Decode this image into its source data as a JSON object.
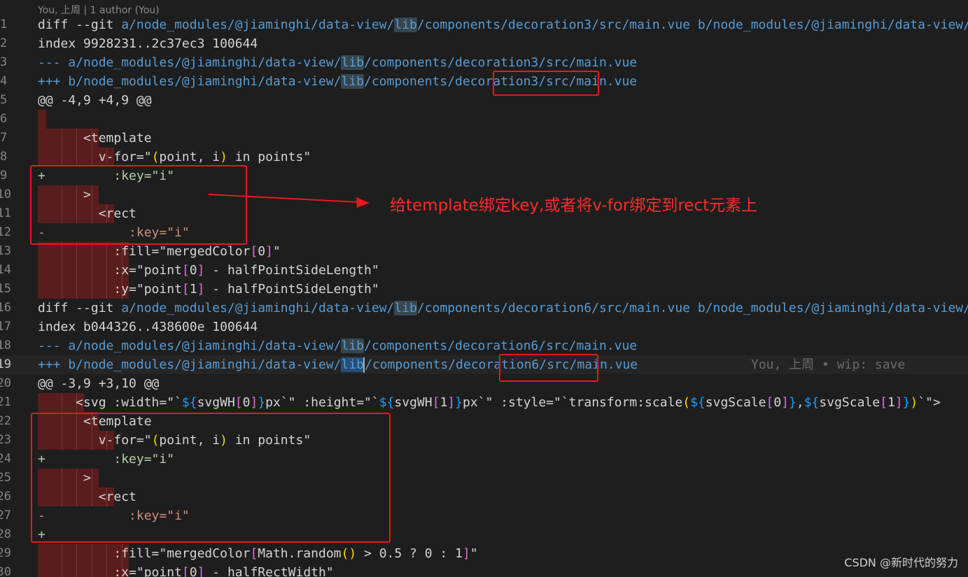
{
  "codelens": "You, 上周 | 1 author (You)",
  "blame": "You, 上周 • wip: save",
  "annotation": "给template绑定key,或者将v-for绑定到rect元素上",
  "watermark": "CSDN @新时代的努力",
  "lines": [
    {
      "n": "1",
      "segs": [
        {
          "c": "meta",
          "t": "diff --git "
        },
        {
          "c": "path",
          "t": "a/node_modules/@jiaminghi/data-view/"
        },
        {
          "c": "path hlword",
          "t": "lib"
        },
        {
          "c": "path",
          "t": "/components/decoration3/src/main.vue b/node_modules/@jiaminghi/data-view/lib/components/decoration3/src/main.vue"
        }
      ]
    },
    {
      "n": "2",
      "segs": [
        {
          "c": "meta",
          "t": "index 9928231..2c37ec3 100644"
        }
      ]
    },
    {
      "n": "3",
      "segs": [
        {
          "c": "path",
          "t": "--- a/node_modules/@jiaminghi/data-view/"
        },
        {
          "c": "path hlword",
          "t": "lib"
        },
        {
          "c": "path",
          "t": "/components/decoration3/src/main.vue"
        }
      ]
    },
    {
      "n": "4",
      "segs": [
        {
          "c": "path",
          "t": "+++ b/node_modules/@jiaminghi/data-view/"
        },
        {
          "c": "path hlword",
          "t": "lib"
        },
        {
          "c": "path",
          "t": "/components/decoration3/src/main.vue"
        }
      ]
    },
    {
      "n": "5",
      "segs": [
        {
          "c": "meta",
          "t": "@@ -4,9 +4,9 @@"
        }
      ]
    },
    {
      "n": "6",
      "indent": 1,
      "segs": []
    },
    {
      "n": "7",
      "indent": 4,
      "segs": [
        {
          "c": "tag",
          "t": "      <template"
        }
      ]
    },
    {
      "n": "8",
      "indent": 5,
      "segs": [
        {
          "c": "attr",
          "t": "        v-for=\""
        },
        {
          "c": "paren",
          "t": "("
        },
        {
          "c": "attr",
          "t": "point, i"
        },
        {
          "c": "paren",
          "t": ")"
        },
        {
          "c": "attr",
          "t": " in points\""
        }
      ]
    },
    {
      "n": "9",
      "segs": [
        {
          "c": "add",
          "t": "+         :key=\"i\""
        }
      ]
    },
    {
      "n": "10",
      "indent": 4,
      "segs": [
        {
          "c": "tag",
          "t": "      >"
        }
      ]
    },
    {
      "n": "11",
      "indent": 5,
      "segs": [
        {
          "c": "tag",
          "t": "        <rect"
        }
      ]
    },
    {
      "n": "12",
      "segs": [
        {
          "c": "del",
          "t": "-           :key=\"i\""
        }
      ]
    },
    {
      "n": "13",
      "indent": 6,
      "segs": [
        {
          "c": "attr",
          "t": "          :fill=\"mergedColor"
        },
        {
          "c": "idx",
          "t": "["
        },
        {
          "c": "attr",
          "t": "0"
        },
        {
          "c": "idx",
          "t": "]"
        },
        {
          "c": "attr",
          "t": "\""
        }
      ]
    },
    {
      "n": "14",
      "indent": 6,
      "segs": [
        {
          "c": "attr",
          "t": "          :x=\"point"
        },
        {
          "c": "idx",
          "t": "["
        },
        {
          "c": "attr",
          "t": "0"
        },
        {
          "c": "idx",
          "t": "]"
        },
        {
          "c": "attr",
          "t": " - halfPointSideLength\""
        }
      ]
    },
    {
      "n": "15",
      "indent": 6,
      "segs": [
        {
          "c": "attr",
          "t": "          :y=\"point"
        },
        {
          "c": "idx",
          "t": "["
        },
        {
          "c": "attr",
          "t": "1"
        },
        {
          "c": "idx",
          "t": "]"
        },
        {
          "c": "attr",
          "t": " - halfPointSideLength\""
        }
      ]
    },
    {
      "n": "16",
      "segs": [
        {
          "c": "meta",
          "t": "diff --git "
        },
        {
          "c": "path",
          "t": "a/node_modules/@jiaminghi/data-view/"
        },
        {
          "c": "path hlword",
          "t": "lib"
        },
        {
          "c": "path",
          "t": "/components/decoration6/src/main.vue b/node_modules/@jiaminghi/data-view/lib/components/decoration6/src/main.vue"
        }
      ]
    },
    {
      "n": "17",
      "segs": [
        {
          "c": "meta",
          "t": "index b044326..438600e 100644"
        }
      ]
    },
    {
      "n": "18",
      "segs": [
        {
          "c": "path",
          "t": "--- a/node_modules/@jiaminghi/data-view/"
        },
        {
          "c": "path hlword",
          "t": "lib"
        },
        {
          "c": "path",
          "t": "/components/decoration6/src/main.vue"
        }
      ]
    },
    {
      "n": "19",
      "cursor": true,
      "segs": [
        {
          "c": "path",
          "t": "+++ b/node_modules/@jiaminghi/data-view/"
        },
        {
          "c": "path hlword strong",
          "t": "lib"
        },
        {
          "c": "caret",
          "t": ""
        },
        {
          "c": "path",
          "t": "/components/decoration6/src/main.vue"
        }
      ]
    },
    {
      "n": "20",
      "segs": [
        {
          "c": "meta",
          "t": "@@ -3,9 +3,10 @@"
        }
      ]
    },
    {
      "n": "21",
      "indent": 3,
      "segs": [
        {
          "c": "tag",
          "t": "     <svg :width=\"`"
        },
        {
          "c": "brace",
          "t": "${"
        },
        {
          "c": "attr",
          "t": "svgWH"
        },
        {
          "c": "idx",
          "t": "["
        },
        {
          "c": "attr",
          "t": "0"
        },
        {
          "c": "idx",
          "t": "]"
        },
        {
          "c": "brace",
          "t": "}"
        },
        {
          "c": "attr",
          "t": "px`\" :height=\"`"
        },
        {
          "c": "brace",
          "t": "${"
        },
        {
          "c": "attr",
          "t": "svgWH"
        },
        {
          "c": "idx",
          "t": "["
        },
        {
          "c": "attr",
          "t": "1"
        },
        {
          "c": "idx",
          "t": "]"
        },
        {
          "c": "brace",
          "t": "}"
        },
        {
          "c": "attr",
          "t": "px`\" :style=\"`transform:scale"
        },
        {
          "c": "paren",
          "t": "("
        },
        {
          "c": "brace",
          "t": "${"
        },
        {
          "c": "attr",
          "t": "svgScale"
        },
        {
          "c": "idx",
          "t": "["
        },
        {
          "c": "attr",
          "t": "0"
        },
        {
          "c": "idx",
          "t": "]"
        },
        {
          "c": "brace",
          "t": "}"
        },
        {
          "c": "attr",
          "t": ","
        },
        {
          "c": "brace",
          "t": "${"
        },
        {
          "c": "attr",
          "t": "svgScale"
        },
        {
          "c": "idx",
          "t": "["
        },
        {
          "c": "attr",
          "t": "1"
        },
        {
          "c": "idx",
          "t": "]"
        },
        {
          "c": "brace",
          "t": "}"
        },
        {
          "c": "paren",
          "t": ")"
        },
        {
          "c": "attr",
          "t": "`\">"
        }
      ]
    },
    {
      "n": "22",
      "indent": 4,
      "segs": [
        {
          "c": "tag",
          "t": "      <template"
        }
      ]
    },
    {
      "n": "23",
      "indent": 5,
      "segs": [
        {
          "c": "attr",
          "t": "        v-for=\""
        },
        {
          "c": "paren",
          "t": "("
        },
        {
          "c": "attr",
          "t": "point, i"
        },
        {
          "c": "paren",
          "t": ")"
        },
        {
          "c": "attr",
          "t": " in points\""
        }
      ]
    },
    {
      "n": "24",
      "segs": [
        {
          "c": "add",
          "t": "+         :key=\"i\""
        }
      ]
    },
    {
      "n": "25",
      "indent": 4,
      "segs": [
        {
          "c": "tag",
          "t": "      >"
        }
      ]
    },
    {
      "n": "26",
      "indent": 5,
      "segs": [
        {
          "c": "tag",
          "t": "        <rect"
        }
      ]
    },
    {
      "n": "27",
      "segs": [
        {
          "c": "del",
          "t": "-           :key=\"i\""
        }
      ]
    },
    {
      "n": "28",
      "segs": [
        {
          "c": "add",
          "t": "+"
        }
      ]
    },
    {
      "n": "29",
      "indent": 6,
      "segs": [
        {
          "c": "attr",
          "t": "          :fill=\"mergedColor"
        },
        {
          "c": "idx",
          "t": "["
        },
        {
          "c": "attr",
          "t": "Math.random"
        },
        {
          "c": "paren",
          "t": "()"
        },
        {
          "c": "attr",
          "t": " > 0.5 ? 0 : 1"
        },
        {
          "c": "idx",
          "t": "]"
        },
        {
          "c": "attr",
          "t": "\""
        }
      ]
    },
    {
      "n": "30",
      "indent": 6,
      "segs": [
        {
          "c": "attr",
          "t": "          :x=\"point"
        },
        {
          "c": "idx",
          "t": "["
        },
        {
          "c": "attr",
          "t": "0"
        },
        {
          "c": "idx",
          "t": "]"
        },
        {
          "c": "attr",
          "t": " - halfRectWidth\""
        }
      ]
    }
  ]
}
